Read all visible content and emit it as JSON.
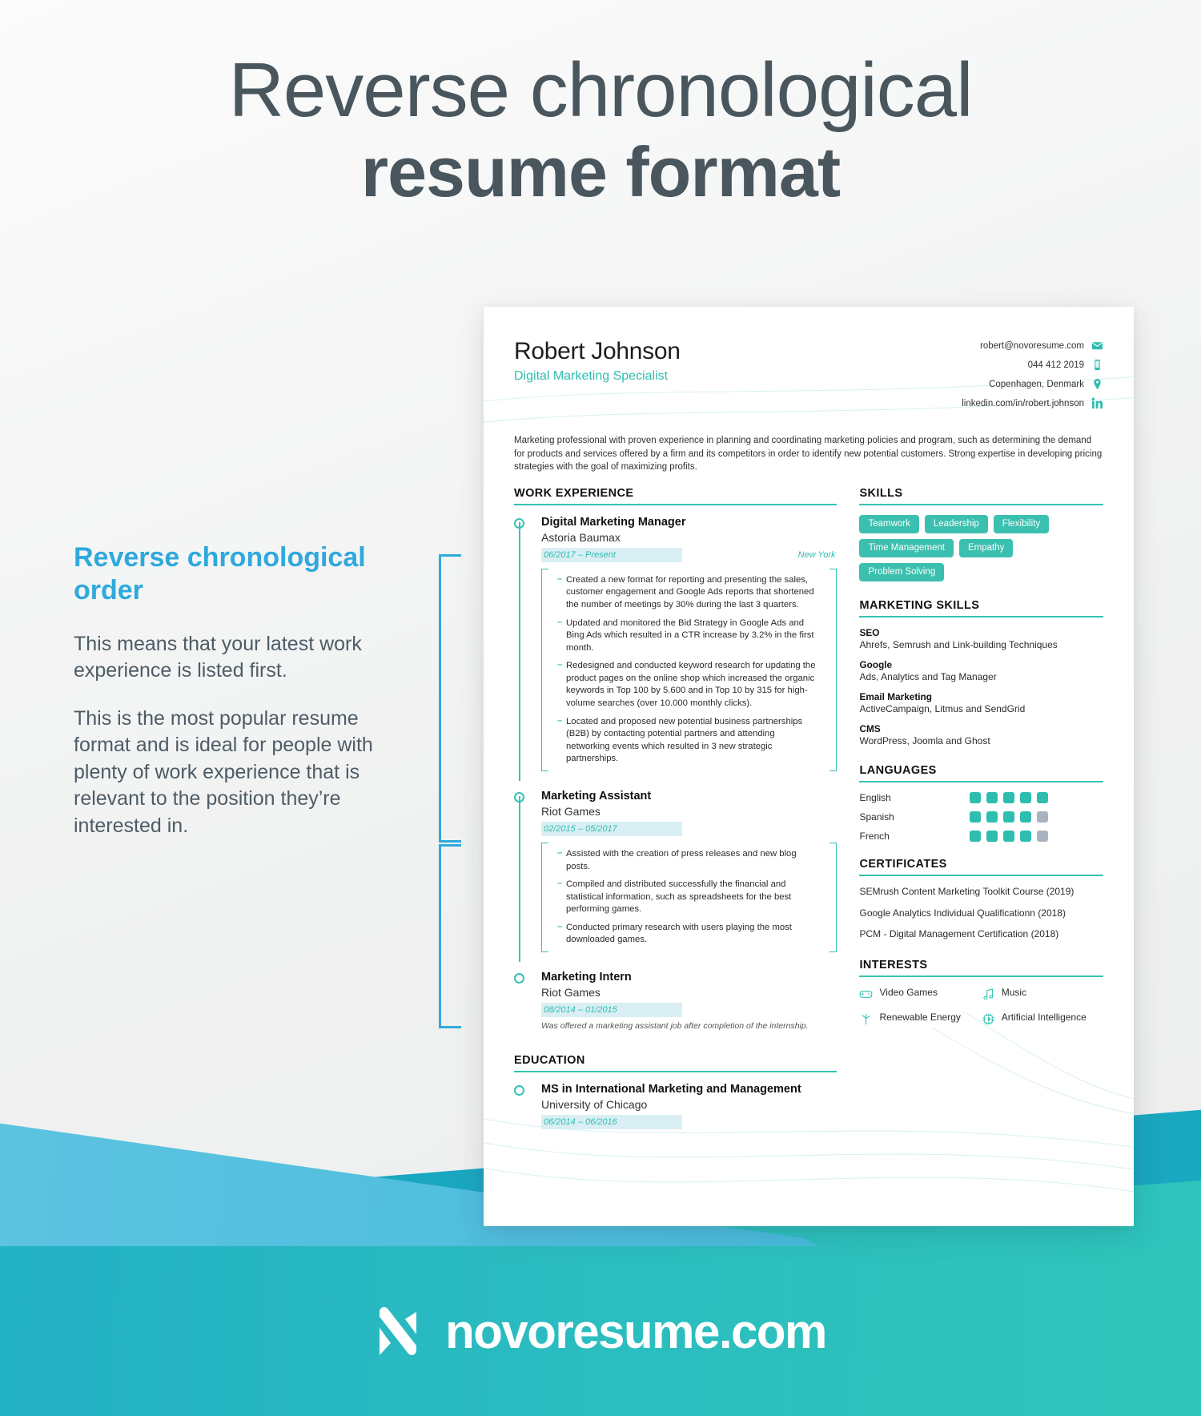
{
  "headline": {
    "line1": "Reverse chronological",
    "line2": "resume format"
  },
  "explainer": {
    "heading": "Reverse chronological order",
    "paragraph1": "This means that your latest work experience is listed first.",
    "paragraph2": "This is the most popular resume format and is ideal for people with plenty of work experience that is relevant to the position they’re interested in."
  },
  "colors": {
    "accent_blue": "#2fa9dd",
    "accent_teal": "#35c2b4",
    "tag_teal": "#3bbfae",
    "heading_gray": "#4a565e",
    "dot_off": "#a9b3c0"
  },
  "resume": {
    "name": "Robert Johnson",
    "job_title": "Digital Marketing Specialist",
    "contacts": [
      {
        "icon": "email-icon",
        "value": "robert@novoresume.com"
      },
      {
        "icon": "phone-icon",
        "value": "044 412 2019"
      },
      {
        "icon": "location-pin-icon",
        "value": "Copenhagen, Denmark"
      },
      {
        "icon": "linkedin-icon",
        "value": "linkedin.com/in/robert.johnson"
      }
    ],
    "summary": "Marketing professional with proven experience in planning and coordinating marketing policies and program, such as determining the demand for products and services offered by a firm and its competitors in order to identify new potential customers. Strong expertise in developing pricing strategies with the goal of maximizing profits.",
    "sections": {
      "work_experience_title": "WORK EXPERIENCE",
      "education_title": "EDUCATION",
      "skills_title": "SKILLS",
      "marketing_skills_title": "MARKETING SKILLS",
      "languages_title": "LANGUAGES",
      "certificates_title": "CERTIFICATES",
      "interests_title": "INTERESTS"
    },
    "work_experience": [
      {
        "role": "Digital Marketing Manager",
        "company": "Astoria Baumax",
        "date": "06/2017 – Present",
        "location": "New York",
        "bullets": [
          "Created a new format for reporting and presenting the sales, customer engagement and Google Ads reports that shortened the number of meetings by 30% during the last 3 quarters.",
          "Updated and monitored the Bid Strategy in Google Ads and Bing Ads which resulted in a CTR increase by 3.2% in the first month.",
          "Redesigned and conducted keyword research for updating the product pages on the online shop which increased the organic keywords in Top 100 by 5.600 and in Top 10 by 315 for high-volume searches (over 10.000 monthly clicks).",
          "Located and proposed new potential business partnerships (B2B) by contacting potential partners and attending networking events which resulted in 3 new strategic partnerships."
        ]
      },
      {
        "role": "Marketing Assistant",
        "company": "Riot Games",
        "date": "02/2015 – 05/2017",
        "location": "",
        "bullets": [
          "Assisted with the creation of press releases and new blog posts.",
          "Compiled and distributed successfully the financial and statistical information, such as spreadsheets for the best performing games.",
          "Conducted primary research with users playing the most downloaded games."
        ]
      },
      {
        "role": "Marketing Intern",
        "company": "Riot Games",
        "date": "08/2014 – 01/2015",
        "location": "",
        "note": "Was offered a marketing assistant job after completion of the internship.",
        "bullets": []
      }
    ],
    "education": [
      {
        "degree": "MS in International Marketing and Management",
        "school": "University of Chicago",
        "date": "06/2014 – 06/2016"
      }
    ],
    "skills": [
      "Teamwork",
      "Leadership",
      "Flexibility",
      "Time Management",
      "Empathy",
      "Problem Solving"
    ],
    "marketing_skills": [
      {
        "name": "SEO",
        "detail": "Ahrefs, Semrush and Link-building Techniques"
      },
      {
        "name": "Google",
        "detail": "Ads, Analytics and Tag Manager"
      },
      {
        "name": "Email Marketing",
        "detail": "ActiveCampaign, Litmus and SendGrid"
      },
      {
        "name": "CMS",
        "detail": "WordPress, Joomla and Ghost"
      }
    ],
    "languages": [
      {
        "name": "English",
        "level": 5,
        "max": 5
      },
      {
        "name": "Spanish",
        "level": 4,
        "max": 5
      },
      {
        "name": "French",
        "level": 4,
        "max": 5
      }
    ],
    "certificates": [
      "SEMrush Content Marketing Toolkit Course (2019)",
      "Google Analytics Individual Qualificationn (2018)",
      "PCM - Digital Management Certification (2018)"
    ],
    "interests": [
      {
        "icon": "gamepad-icon",
        "label": "Video Games"
      },
      {
        "icon": "music-note-icon",
        "label": "Music"
      },
      {
        "icon": "wind-turbine-icon",
        "label": "Renewable Energy"
      },
      {
        "icon": "cpu-chip-icon",
        "label": "Artificial Intelligence"
      }
    ]
  },
  "footer": {
    "brand": "novoresume.com"
  }
}
